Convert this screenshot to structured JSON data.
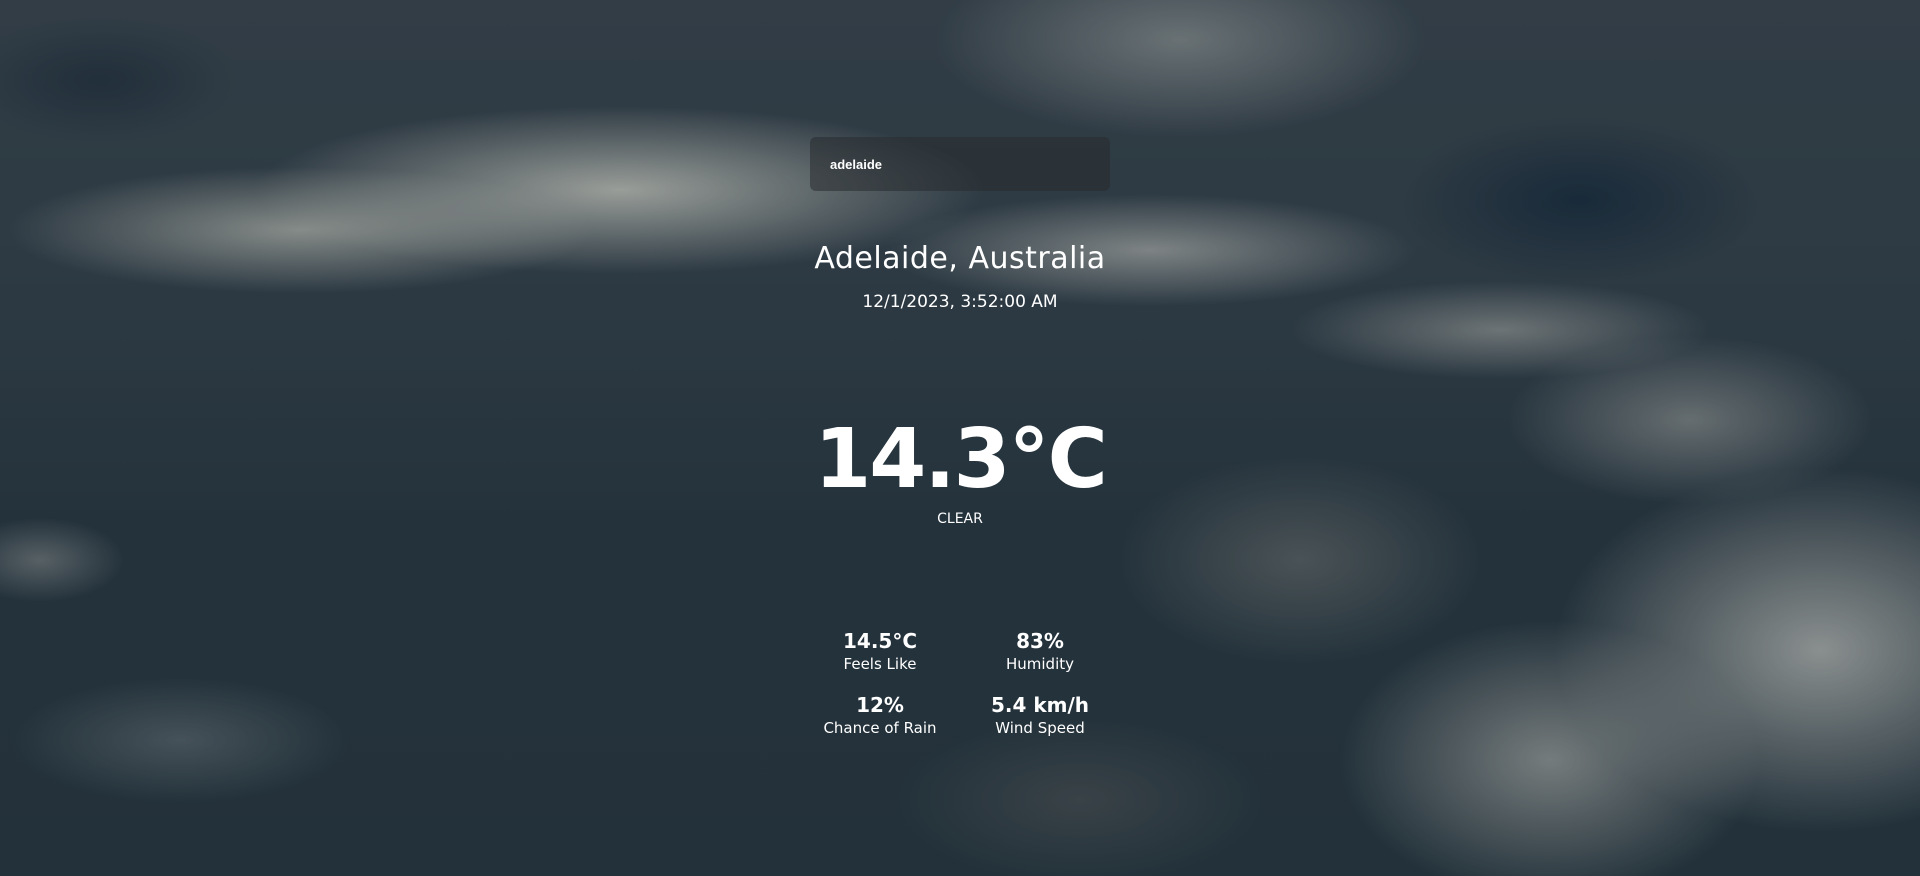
{
  "search": {
    "value": "adelaide",
    "placeholder": ""
  },
  "weather": {
    "location": "Adelaide, Australia",
    "datetime": "12/1/2023, 3:52:00 AM",
    "temperature": "14.3°C",
    "condition": "CLEAR"
  },
  "stats": [
    {
      "value": "14.5°C",
      "label": "Feels Like"
    },
    {
      "value": "83%",
      "label": "Humidity"
    },
    {
      "value": "12%",
      "label": "Chance of Rain"
    },
    {
      "value": "5.4 km/h",
      "label": "Wind Speed"
    }
  ]
}
